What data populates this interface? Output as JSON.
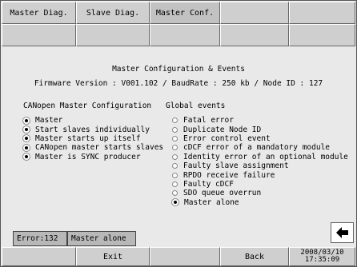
{
  "tabs": [
    "Master Diag.",
    "Slave Diag.",
    "Master Conf."
  ],
  "title": "Master Configuration & Events",
  "info": "Firmware Version : V001.102 / BaudRate :  250 kb / Node ID : 127",
  "master_config": {
    "heading": "CANopen Master Configuration",
    "items": [
      {
        "label": "Master",
        "selected": true
      },
      {
        "label": "Start slaves individually",
        "selected": true
      },
      {
        "label": "Master starts up itself",
        "selected": true
      },
      {
        "label": "CANopen master starts slaves",
        "selected": true
      },
      {
        "label": "Master is SYNC producer",
        "selected": true
      }
    ]
  },
  "global_events": {
    "heading": "Global events",
    "items": [
      {
        "label": "Fatal error",
        "selected": false
      },
      {
        "label": "Duplicate Node ID",
        "selected": false
      },
      {
        "label": "Error control event",
        "selected": false
      },
      {
        "label": "cDCF error of a mandatory module",
        "selected": false
      },
      {
        "label": "Identity error of an optional module",
        "selected": false
      },
      {
        "label": "Faulty slave assignment",
        "selected": false
      },
      {
        "label": "RPDO receive failure",
        "selected": false
      },
      {
        "label": "Faulty cDCF",
        "selected": false
      },
      {
        "label": "SDO queue overrun",
        "selected": false
      },
      {
        "label": "Master alone",
        "selected": true
      }
    ]
  },
  "status": {
    "error": "Error:132",
    "message": "Master alone"
  },
  "buttons": {
    "exit": "Exit",
    "back": "Back"
  },
  "datetime": {
    "date": "2008/03/10",
    "time": "17:35:09"
  },
  "icons": {
    "back_arrow": "left-arrow-icon"
  },
  "colors": {
    "background": "#e9e9e9",
    "button": "#cfcfcf",
    "status_bar": "#b8b8b8"
  }
}
